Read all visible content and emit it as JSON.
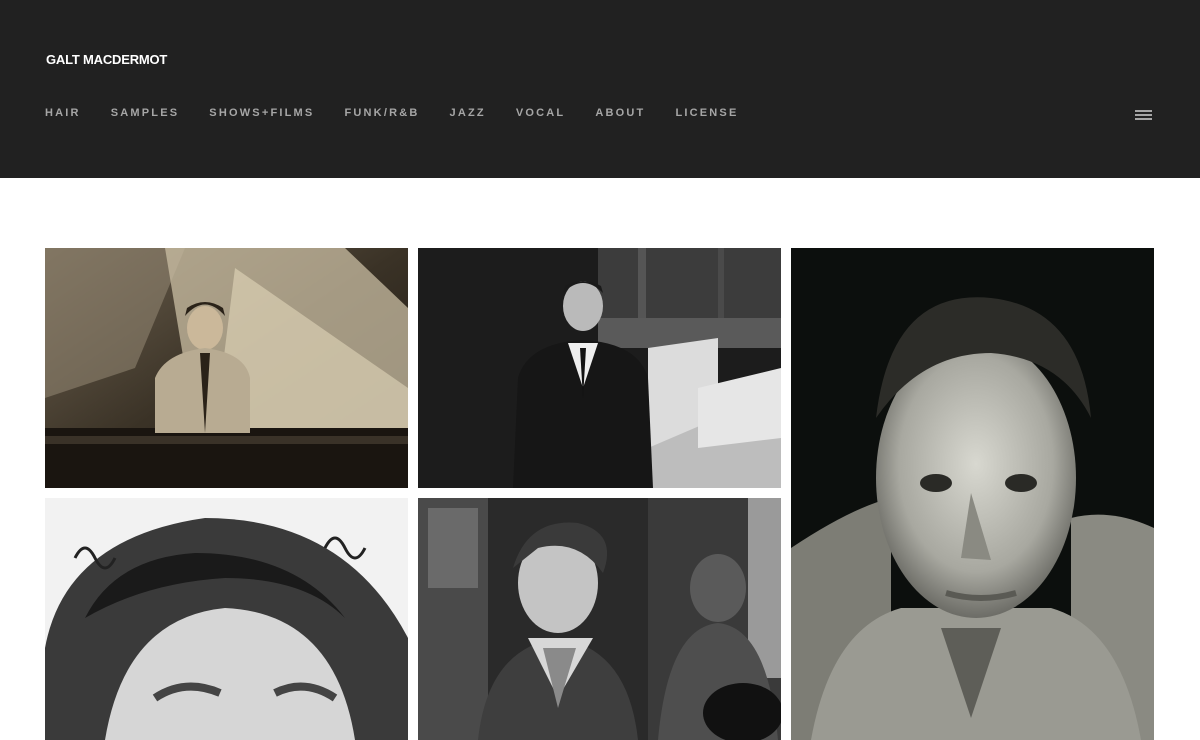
{
  "site": {
    "title": "GALT MACDERMOT"
  },
  "nav": {
    "items": [
      {
        "label": "HAIR"
      },
      {
        "label": "SAMPLES"
      },
      {
        "label": "SHOWS+FILMS"
      },
      {
        "label": "FUNK/R&B"
      },
      {
        "label": "JAZZ"
      },
      {
        "label": "VOCAL"
      },
      {
        "label": "ABOUT"
      },
      {
        "label": "LICENSE"
      }
    ],
    "menu_icon": "hamburger-menu-icon"
  },
  "colors": {
    "header_bg": "#212121",
    "nav_text": "#a6a6a6",
    "title_text": "#ffffff",
    "page_bg": "#ffffff"
  },
  "gallery": {
    "photos": [
      {
        "subject": "man in suit seated at grand piano",
        "tone": "sepia"
      },
      {
        "subject": "man in sweater at desk with scores",
        "tone": "black-and-white"
      },
      {
        "subject": "close-up portrait of man",
        "tone": "black-and-white"
      },
      {
        "subject": "close-up of man with curly hair",
        "tone": "black-and-white"
      },
      {
        "subject": "man with guitarist in background",
        "tone": "black-and-white"
      }
    ]
  }
}
